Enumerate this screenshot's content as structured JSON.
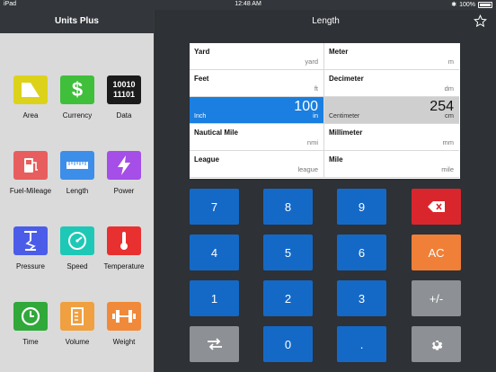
{
  "status": {
    "device": "iPad",
    "time": "12:48 AM",
    "battery": "100%"
  },
  "sidebar": {
    "title": "Units Plus",
    "categories": [
      {
        "label": "Area",
        "color": "#ddd21a",
        "icon": "area-icon"
      },
      {
        "label": "Currency",
        "color": "#3fbf3a",
        "icon": "dollar-icon",
        "glyph": "$"
      },
      {
        "label": "Data",
        "color": "#1b1b1b",
        "icon": "binary-icon",
        "glyph1": "10010",
        "glyph2": "11101"
      },
      {
        "label": "Fuel-Mileage",
        "color": "#e85e5e",
        "icon": "fuel-pump-icon"
      },
      {
        "label": "Length",
        "color": "#3d8ee8",
        "icon": "ruler-icon"
      },
      {
        "label": "Power",
        "color": "#a54ee8",
        "icon": "lightning-icon"
      },
      {
        "label": "Pressure",
        "color": "#4b5de8",
        "icon": "pressure-icon"
      },
      {
        "label": "Speed",
        "color": "#1ec8b6",
        "icon": "speedometer-icon"
      },
      {
        "label": "Temperature",
        "color": "#e83030",
        "icon": "thermometer-icon"
      },
      {
        "label": "Time",
        "color": "#30a83a",
        "icon": "clock-icon"
      },
      {
        "label": "Volume",
        "color": "#f0a040",
        "icon": "beaker-icon"
      },
      {
        "label": "Weight",
        "color": "#f08a3a",
        "icon": "dumbbell-icon"
      }
    ]
  },
  "main": {
    "title": "Length",
    "units": [
      {
        "left": {
          "name": "Yard",
          "unit": "yard"
        },
        "right": {
          "name": "Meter",
          "unit": "m"
        }
      },
      {
        "left": {
          "name": "Feet",
          "unit": "ft"
        },
        "right": {
          "name": "Decimeter",
          "unit": "dm"
        }
      },
      {
        "left": {
          "sub": "Inch",
          "value": "100",
          "unit": "in"
        },
        "right": {
          "sub": "Centimeter",
          "value": "254",
          "unit": "cm"
        }
      },
      {
        "left": {
          "name": "Nautical Mile",
          "unit": "nmi"
        },
        "right": {
          "name": "Millimeter",
          "unit": "mm"
        }
      },
      {
        "left": {
          "name": "League",
          "unit": "league"
        },
        "right": {
          "name": "Mile",
          "unit": "mile"
        }
      }
    ],
    "keys": {
      "k7": "7",
      "k8": "8",
      "k9": "9",
      "k4": "4",
      "k5": "5",
      "k6": "6",
      "ac": "AC",
      "k1": "1",
      "k2": "2",
      "k3": "3",
      "sign": "+/-",
      "k0": "0",
      "dot": "."
    }
  }
}
